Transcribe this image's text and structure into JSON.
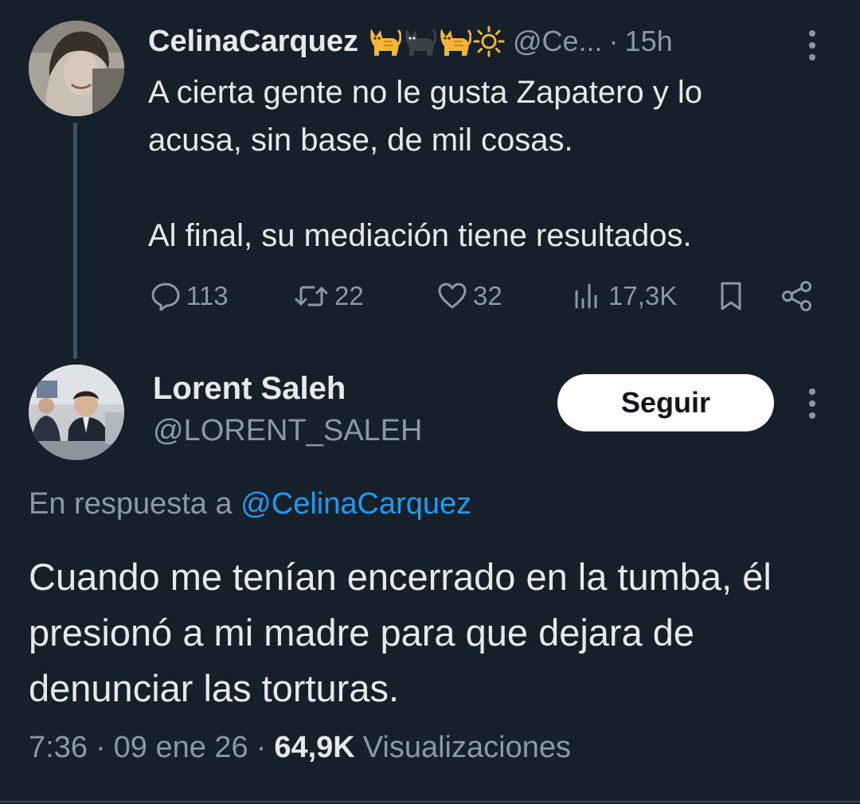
{
  "parent_tweet": {
    "display_name": "CelinaCarquez",
    "name_emojis": [
      "cat-icon",
      "black-cat-icon",
      "cat-icon",
      "sun-icon"
    ],
    "handle": "@Ce...",
    "separator": "·",
    "time": "15h",
    "text": "A cierta gente no le gusta Zapatero y lo\nacusa, sin base, de mil cosas.\n\nAl final, su mediación tiene resultados.",
    "actions": {
      "replies": "113",
      "retweets": "22",
      "likes": "32",
      "views": "17,3K"
    }
  },
  "main_tweet": {
    "display_name": "Lorent Saleh",
    "handle": "@LORENT_SALEH",
    "follow_label": "Seguir",
    "reply_prefix": "En respuesta a",
    "reply_to": "@CelinaCarquez",
    "text": "Cuando me tenían encerrado en la tumba, él presionó a mi madre para que dejara de denunciar las torturas.",
    "time": "7:36",
    "date": "09 ene 26",
    "separator": "·",
    "views_count": "64,9K",
    "views_label": "Visualizaciones"
  },
  "colors": {
    "background": "#15202b",
    "primary_text": "#e7e9ea",
    "secondary_text": "#8b98a5",
    "link": "#1d9bf0",
    "button_bg": "#ffffff"
  }
}
